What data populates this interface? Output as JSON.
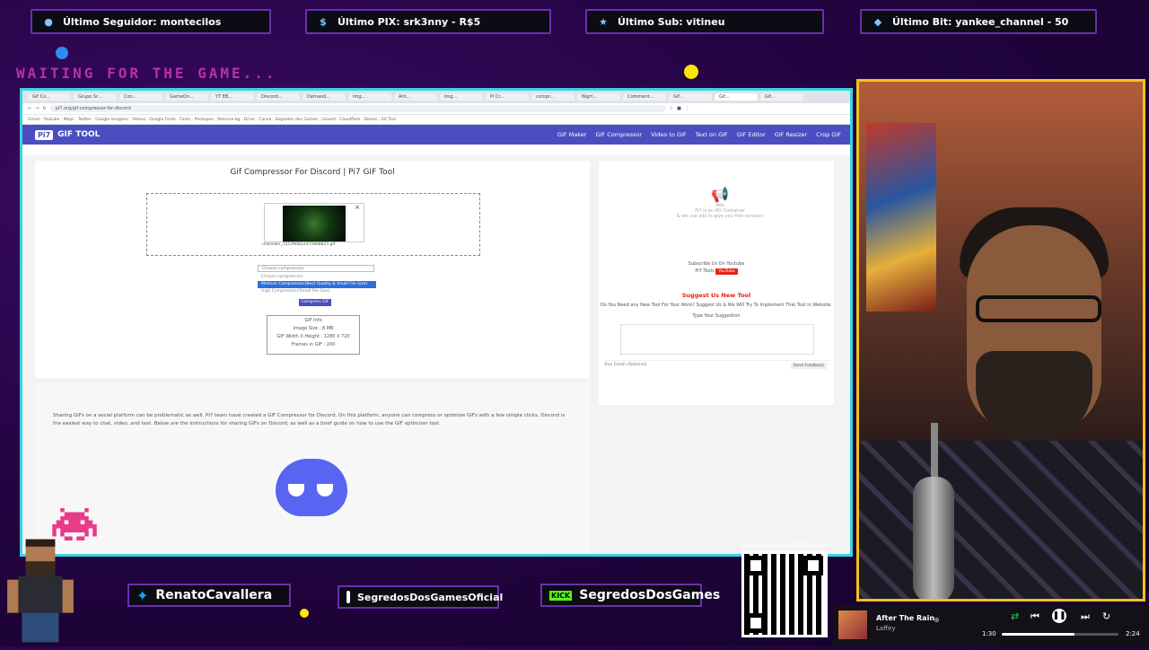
{
  "alerts": {
    "follower": "Último Seguidor: montecilos",
    "pix": "Último PIX: srk3nny - R$5",
    "sub": "Último Sub: vitineu",
    "bit": "Último Bit: yankee_channel - 50"
  },
  "waiting_text": "WAITING FOR THE GAME...",
  "browser": {
    "address": "pi7.org/gif-compressor-for-discord",
    "tabs": [
      "Gif Co...",
      "Grupo Sr...",
      "Con...",
      "GameOn...",
      "YT EB...",
      "Discord...",
      "Demand...",
      "Img...",
      "Ant...",
      "Img...",
      "Pi Cr...",
      "compr...",
      "Nigrt...",
      "Comment...",
      "Gif...",
      "Gif...",
      "Gif..."
    ],
    "bookmarks": "Gmail · Youtube · Maps · Twitter · Google Imagens · Vídeos · Google Fonts · Fonts · Photopea · Remove bg · Drive · Canva · Segredos dos Games · Lineart · Cloudflare · Steam · Gif Tool"
  },
  "site": {
    "brand": "GIF TOOL",
    "brand_badge": "Pi7",
    "nav": [
      "GIF Maker",
      "GIF Compressor",
      "Video to GIF",
      "Text on GIF",
      "GIF Editor",
      "GIF Resizer",
      "Crop GIF"
    ],
    "page_title": "Gif Compressor For Discord | Pi7 GIF Tool",
    "filename": "unknown_155390822472868825.gif",
    "close_label": "×",
    "select_placeholder": "Choose compression",
    "dropdown_options": [
      "Choose compression",
      "Medium Compression(Best Quality & Small File Size)",
      "High Compression(Small File Size)"
    ],
    "compress_button": "Compress GIF",
    "gif_info": {
      "title": "GIF Info",
      "size": "Image Size : 8 MB",
      "dimensions": "GIF Width X Height : 1280 X 720",
      "frames": "Frames in GIF : 200"
    },
    "description": "Sharing GIFs on a social platform can be problematic as well. Pi7 team have created a GIF Compressor for Discord. On this platform, anyone can compress or optimize GIFs with a few simple clicks. Discord is the easiest way to chat, video, and text. Below are the instructions for sharing GIFs on Discord, as well as a brief guide on how to use the GIF optimizer tool.",
    "ad_label": "Ads",
    "ad_line1": "Pi7 is an AD Container",
    "ad_line2": "& we use ads to give you free services",
    "subscribe": "Subscribe Us On Youtube",
    "channel": "Pi7 Tools",
    "youtube_btn": "YouTube",
    "suggest_title": "Suggest Us New Tool",
    "suggest_text": "Do You Need any New Tool For Your Work? Suggest Us & We Will Try To Implement That Tool in Website.",
    "suggest_label": "Type Your Suggestion",
    "email_placeholder": "Your Email (Optional)",
    "submit_label": "Send Feedback"
  },
  "socials": {
    "twitter": "RenatoCavallera",
    "instagram": "SegredosDosGamesOficial",
    "kick_badge": "KICK",
    "kick": "SegredosDosGames",
    "livepix": "livepix.gg/segredosdosgames"
  },
  "player": {
    "title": "After The Rain",
    "artist": "Laffey",
    "elapsed": "1:30",
    "total": "2:24",
    "progress": 0.62
  },
  "colors": {
    "frame_cyan": "#39d3e0",
    "webcam_border": "#f2c21c",
    "site_nav": "#4a4ec0",
    "discord": "#5865f2",
    "waiting_pink": "#e83bd0"
  }
}
